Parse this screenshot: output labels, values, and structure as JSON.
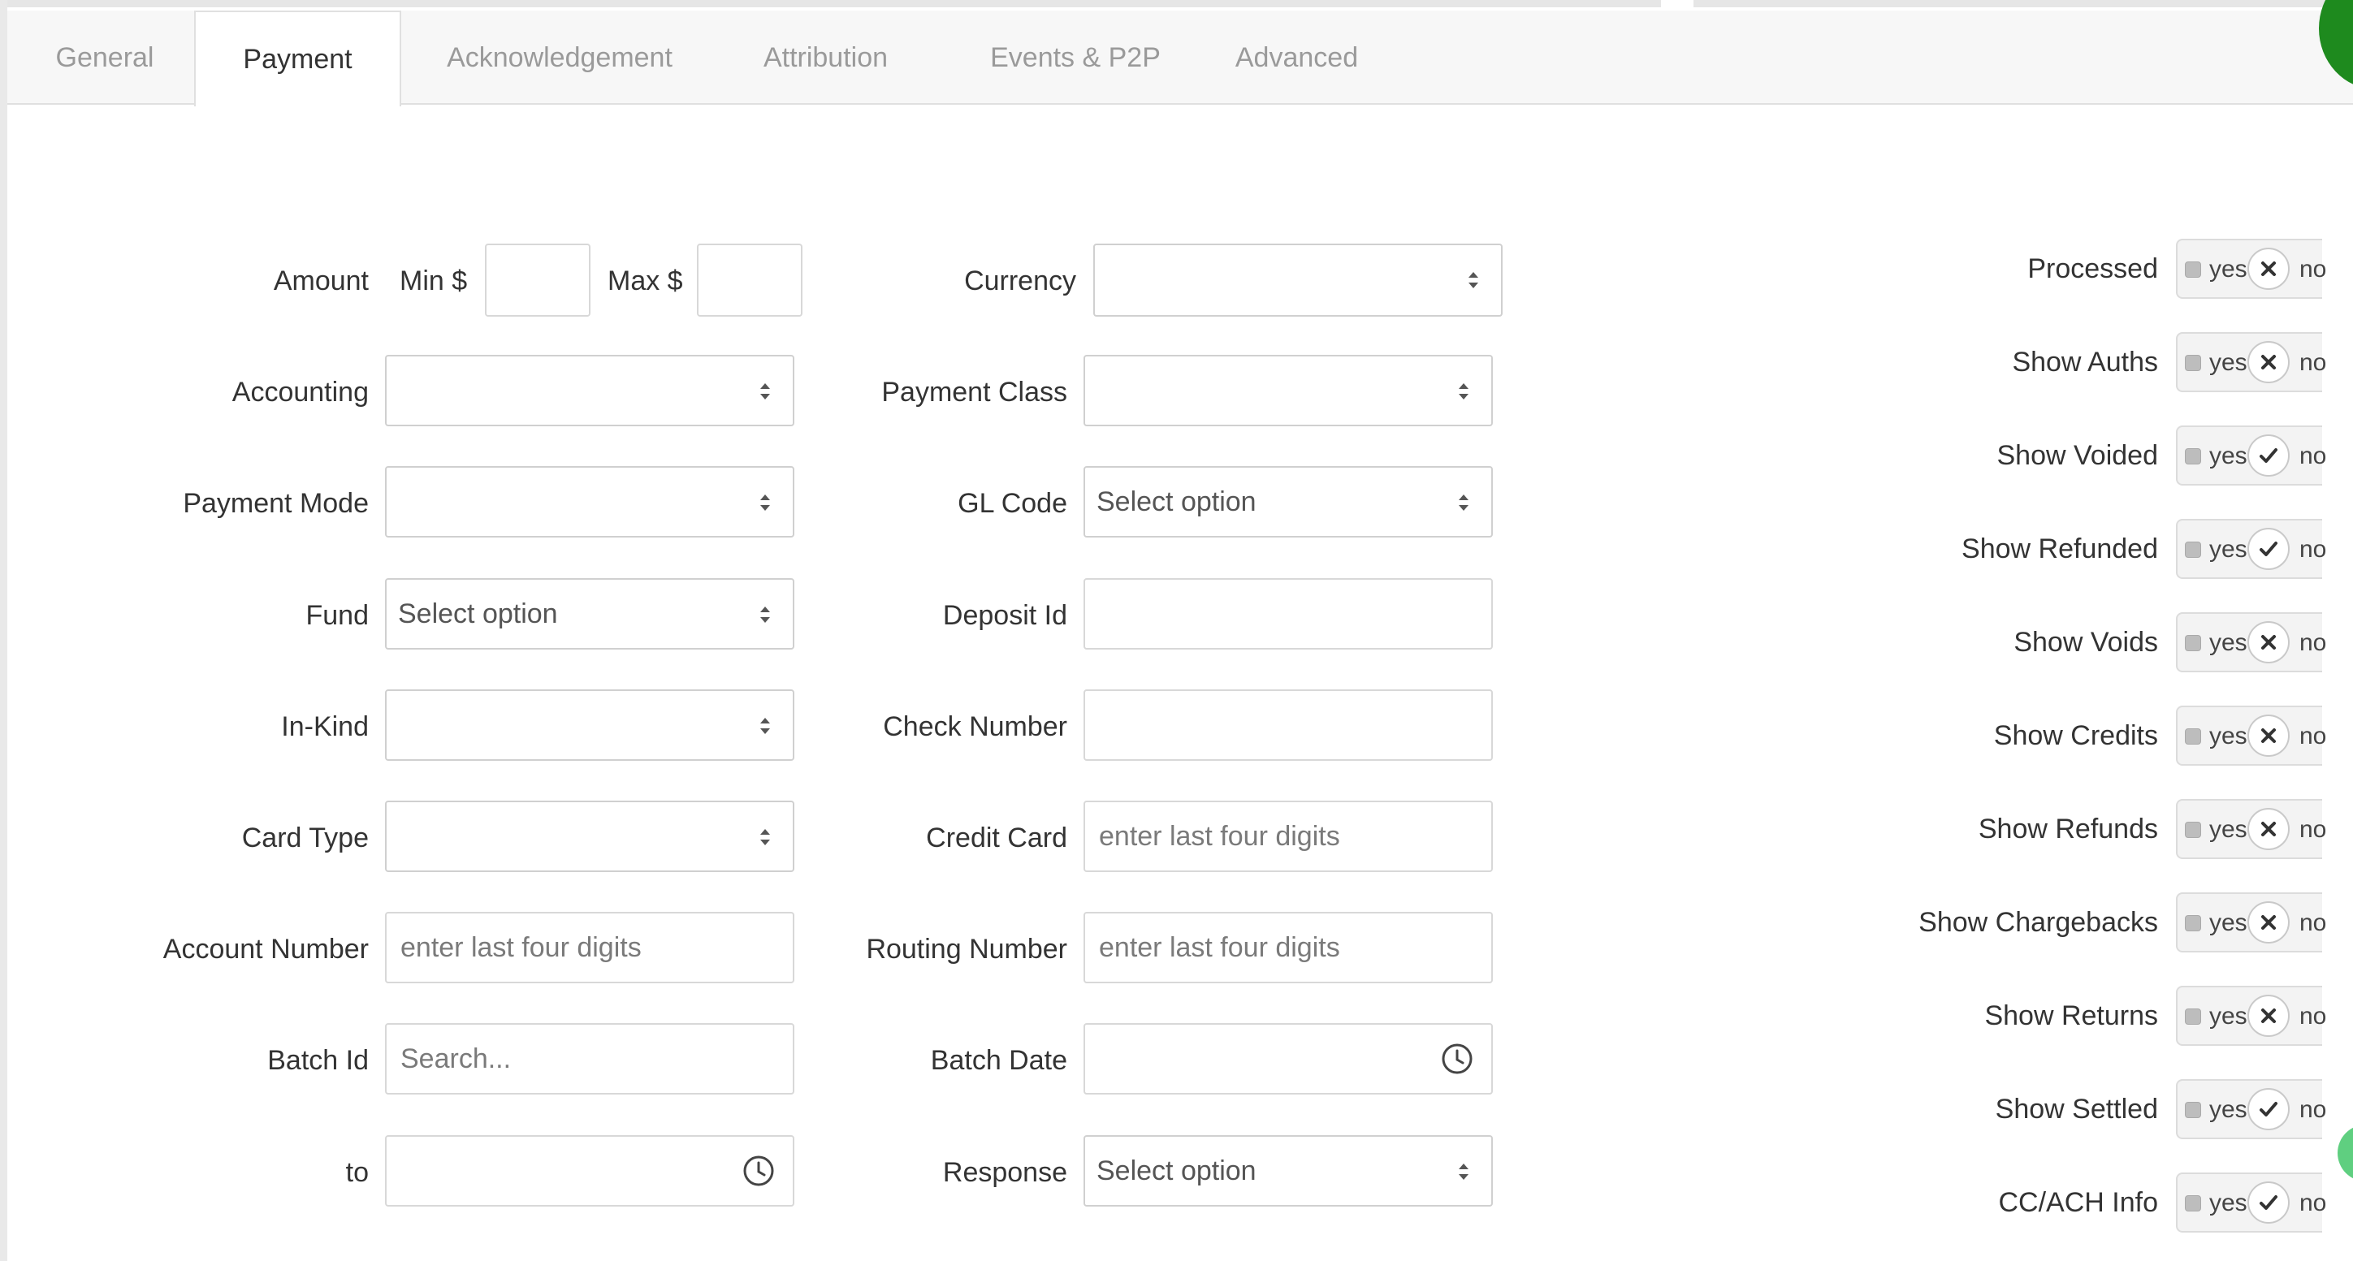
{
  "tabs": [
    {
      "label": "General"
    },
    {
      "label": "Payment"
    },
    {
      "label": "Acknowledgement"
    },
    {
      "label": "Attribution"
    },
    {
      "label": "Events & P2P"
    },
    {
      "label": "Advanced"
    }
  ],
  "active_tab": "Payment",
  "amount": {
    "label": "Amount",
    "min_label": "Min $",
    "max_label": "Max $",
    "min_value": "",
    "max_value": ""
  },
  "left_fields": {
    "accounting": {
      "label": "Accounting",
      "value": ""
    },
    "payment_mode": {
      "label": "Payment Mode",
      "value": ""
    },
    "fund": {
      "label": "Fund",
      "value": "Select option"
    },
    "in_kind": {
      "label": "In-Kind",
      "value": ""
    },
    "card_type": {
      "label": "Card Type",
      "value": ""
    },
    "account_number": {
      "label": "Account Number",
      "placeholder": "enter last four digits"
    },
    "batch_id": {
      "label": "Batch Id",
      "placeholder": "Search..."
    },
    "to": {
      "label": "to",
      "value": ""
    }
  },
  "right_fields": {
    "currency": {
      "label": "Currency",
      "value": ""
    },
    "payment_class": {
      "label": "Payment Class",
      "value": ""
    },
    "gl_code": {
      "label": "GL Code",
      "value": "Select option"
    },
    "deposit_id": {
      "label": "Deposit Id",
      "value": ""
    },
    "check_number": {
      "label": "Check Number",
      "value": ""
    },
    "credit_card": {
      "label": "Credit Card",
      "placeholder": "enter last four digits"
    },
    "routing_number": {
      "label": "Routing Number",
      "placeholder": "enter last four digits"
    },
    "batch_date": {
      "label": "Batch Date",
      "value": ""
    },
    "response": {
      "label": "Response",
      "value": "Select option"
    }
  },
  "toggle_text": {
    "yes": "yes",
    "no": "no"
  },
  "toggles": [
    {
      "label": "Processed",
      "state": "x"
    },
    {
      "label": "Show Auths",
      "state": "x"
    },
    {
      "label": "Show Voided",
      "state": "check"
    },
    {
      "label": "Show Refunded",
      "state": "check"
    },
    {
      "label": "Show Voids",
      "state": "x"
    },
    {
      "label": "Show Credits",
      "state": "x"
    },
    {
      "label": "Show Refunds",
      "state": "x"
    },
    {
      "label": "Show Chargebacks",
      "state": "x"
    },
    {
      "label": "Show Returns",
      "state": "x"
    },
    {
      "label": "Show Settled",
      "state": "check"
    },
    {
      "label": "CC/ACH Info",
      "state": "check"
    }
  ],
  "colors": {
    "accent_green": "#1e8a1e",
    "soft_green": "#5fcf80"
  }
}
